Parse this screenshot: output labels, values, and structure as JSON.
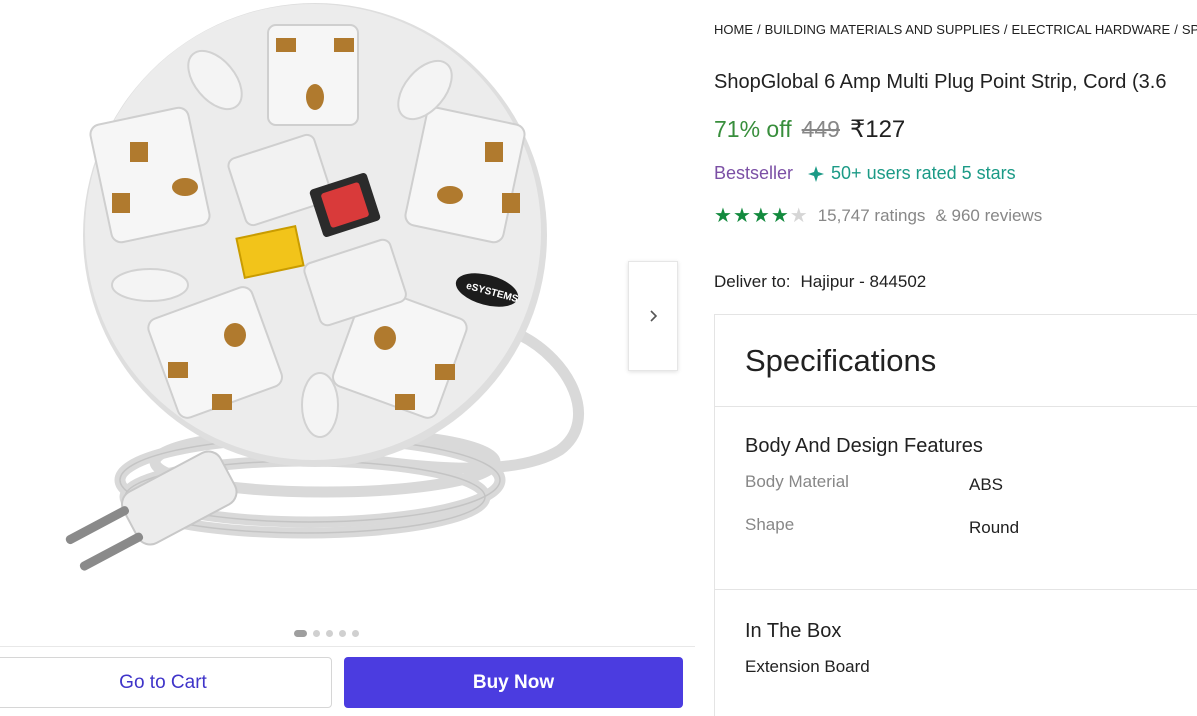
{
  "breadcrumb": [
    "HOME",
    "BUILDING MATERIALS AND SUPPLIES",
    "ELECTRICAL HARDWARE",
    "SPIKE"
  ],
  "product": {
    "title": "ShopGlobal 6 Amp Multi Plug Point Strip, Cord (3.6",
    "discount": "71% off",
    "mrp": "449",
    "price": "₹127",
    "bestseller": "Bestseller",
    "rated_badge": "50+ users rated 5 stars",
    "rating_value": 4,
    "ratings": "15,747 ratings",
    "reviews": "& 960 reviews",
    "brand_label": "eSYSTEMS"
  },
  "delivery": {
    "label": "Deliver to:",
    "location": "Hajipur - 844502"
  },
  "gallery": {
    "image_count": 5,
    "active_index": 0
  },
  "actions": {
    "cart": "Go to Cart",
    "buy": "Buy Now"
  },
  "specifications": {
    "heading": "Specifications",
    "sections": [
      {
        "title": "Body And Design Features",
        "rows": [
          {
            "key": "Body Material",
            "value": "ABS"
          },
          {
            "key": "Shape",
            "value": "Round"
          }
        ]
      },
      {
        "title": "In The Box",
        "items": [
          "Extension Board"
        ]
      }
    ]
  },
  "colors": {
    "accent": "#4b3ce0",
    "discount": "#388e3c",
    "bestseller": "#7b4fa5",
    "rated": "#1b9a86",
    "stars": "#138a3e"
  },
  "icons": {
    "next": "chevron-right-icon",
    "rated": "sparkle-icon",
    "star": "star-icon"
  }
}
